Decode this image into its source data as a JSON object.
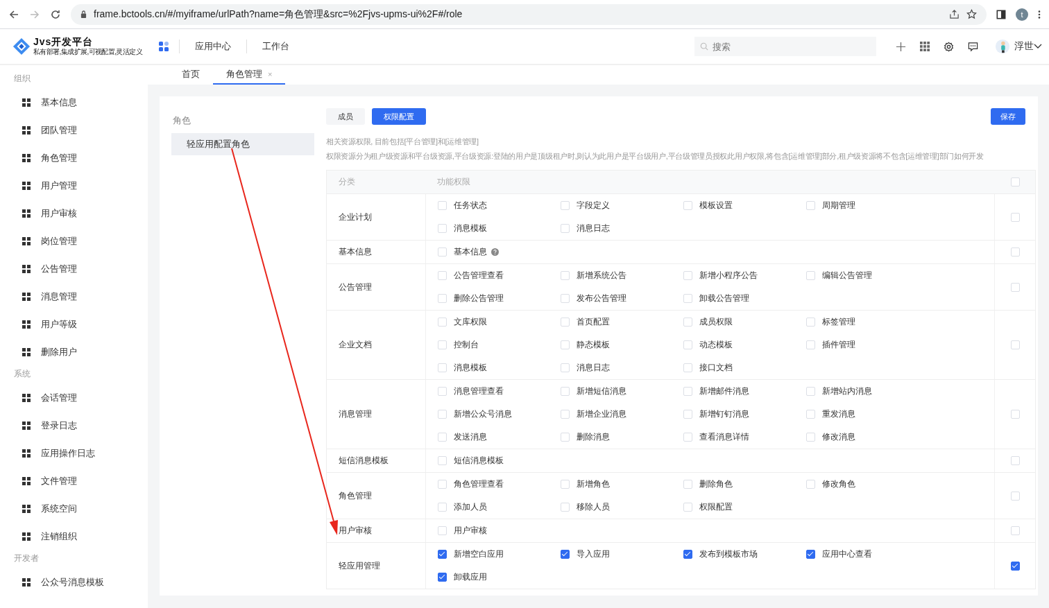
{
  "browser": {
    "url": "frame.bctools.cn/#/myiframe/urlPath?name=角色管理&src=%2Fjvs-upms-ui%2F#/role",
    "profile_initial": "t"
  },
  "header": {
    "logo_title": "Jvs开发平台",
    "logo_subtitle": "私有部署,集成扩展,可视配置,灵活定义",
    "nav": [
      {
        "label": "应用中心"
      },
      {
        "label": "工作台"
      }
    ],
    "search": {
      "placeholder": "搜索"
    },
    "user": {
      "name": "浮世"
    }
  },
  "sidebar": [
    {
      "title": "组织",
      "items": [
        {
          "label": "基本信息"
        },
        {
          "label": "团队管理"
        },
        {
          "label": "角色管理"
        },
        {
          "label": "用户管理"
        },
        {
          "label": "用户审核"
        },
        {
          "label": "岗位管理"
        },
        {
          "label": "公告管理"
        },
        {
          "label": "消息管理"
        },
        {
          "label": "用户等级"
        },
        {
          "label": "删除用户"
        }
      ]
    },
    {
      "title": "系统",
      "items": [
        {
          "label": "会话管理"
        },
        {
          "label": "登录日志"
        },
        {
          "label": "应用操作日志"
        },
        {
          "label": "文件管理"
        },
        {
          "label": "系统空间"
        },
        {
          "label": "注销组织"
        }
      ]
    },
    {
      "title": "开发者",
      "items": [
        {
          "label": "公众号消息模板"
        }
      ]
    }
  ],
  "tabs": [
    {
      "label": "首页",
      "selected": false,
      "closable": false
    },
    {
      "label": "角色管理",
      "selected": true,
      "closable": true,
      "close": "×"
    }
  ],
  "roles": {
    "title": "角色",
    "items": [
      {
        "label": "轻应用配置角色",
        "selected": true
      }
    ]
  },
  "toolbar": {
    "buttons": [
      {
        "label": "成员",
        "selected": false
      },
      {
        "label": "权限配置",
        "selected": true
      }
    ],
    "save": "保存"
  },
  "description": [
    "相关资源权限, 目前包括[平台管理]和[运维管理]",
    "权限资源分为租户级资源和平台级资源,平台级资源:登陆的用户是顶级租户时,则认为此用户是平台级用户,平台级管理员授权此用户权限,将包含[运维管理]部分,租户级资源将不包含[运维管理]部门如何开发"
  ],
  "table": {
    "columns": [
      "分类",
      "功能权限"
    ],
    "header_checked": false,
    "rows": [
      {
        "category": "企业计划",
        "checked": false,
        "permissions": [
          {
            "label": "任务状态",
            "checked": false
          },
          {
            "label": "字段定义",
            "checked": false
          },
          {
            "label": "模板设置",
            "checked": false
          },
          {
            "label": "周期管理",
            "checked": false
          },
          {
            "label": "消息模板",
            "checked": false
          },
          {
            "label": "消息日志",
            "checked": false
          }
        ]
      },
      {
        "category": "基本信息",
        "checked": false,
        "permissions": [
          {
            "label": "基本信息",
            "checked": false,
            "help": true
          }
        ]
      },
      {
        "category": "公告管理",
        "checked": false,
        "permissions": [
          {
            "label": "公告管理查看",
            "checked": false
          },
          {
            "label": "新增系统公告",
            "checked": false
          },
          {
            "label": "新增小程序公告",
            "checked": false
          },
          {
            "label": "编辑公告管理",
            "checked": false
          },
          {
            "label": "删除公告管理",
            "checked": false
          },
          {
            "label": "发布公告管理",
            "checked": false
          },
          {
            "label": "卸载公告管理",
            "checked": false
          }
        ]
      },
      {
        "category": "企业文档",
        "checked": false,
        "permissions": [
          {
            "label": "文库权限",
            "checked": false
          },
          {
            "label": "首页配置",
            "checked": false
          },
          {
            "label": "成员权限",
            "checked": false
          },
          {
            "label": "标签管理",
            "checked": false
          },
          {
            "label": "控制台",
            "checked": false
          },
          {
            "label": "静态模板",
            "checked": false
          },
          {
            "label": "动态模板",
            "checked": false
          },
          {
            "label": "插件管理",
            "checked": false
          },
          {
            "label": "消息模板",
            "checked": false
          },
          {
            "label": "消息日志",
            "checked": false
          },
          {
            "label": "接口文档",
            "checked": false
          }
        ]
      },
      {
        "category": "消息管理",
        "checked": false,
        "permissions": [
          {
            "label": "消息管理查看",
            "checked": false
          },
          {
            "label": "新增短信消息",
            "checked": false
          },
          {
            "label": "新增邮件消息",
            "checked": false
          },
          {
            "label": "新增站内消息",
            "checked": false
          },
          {
            "label": "新增公众号消息",
            "checked": false
          },
          {
            "label": "新增企业消息",
            "checked": false
          },
          {
            "label": "新增钉钉消息",
            "checked": false
          },
          {
            "label": "重发消息",
            "checked": false
          },
          {
            "label": "发送消息",
            "checked": false
          },
          {
            "label": "删除消息",
            "checked": false
          },
          {
            "label": "查看消息详情",
            "checked": false
          },
          {
            "label": "修改消息",
            "checked": false
          }
        ]
      },
      {
        "category": "短信消息模板",
        "checked": false,
        "permissions": [
          {
            "label": "短信消息模板",
            "checked": false
          }
        ]
      },
      {
        "category": "角色管理",
        "checked": false,
        "permissions": [
          {
            "label": "角色管理查看",
            "checked": false
          },
          {
            "label": "新增角色",
            "checked": false
          },
          {
            "label": "删除角色",
            "checked": false
          },
          {
            "label": "修改角色",
            "checked": false
          },
          {
            "label": "添加人员",
            "checked": false
          },
          {
            "label": "移除人员",
            "checked": false
          },
          {
            "label": "权限配置",
            "checked": false
          }
        ]
      },
      {
        "category": "用户审核",
        "checked": false,
        "permissions": [
          {
            "label": "用户审核",
            "checked": false
          }
        ]
      },
      {
        "category": "轻应用管理",
        "checked": true,
        "permissions": [
          {
            "label": "新增空白应用",
            "checked": true
          },
          {
            "label": "导入应用",
            "checked": true
          },
          {
            "label": "发布到模板市场",
            "checked": true
          },
          {
            "label": "应用中心查看",
            "checked": true
          },
          {
            "label": "卸载应用",
            "checked": true
          }
        ]
      }
    ]
  }
}
